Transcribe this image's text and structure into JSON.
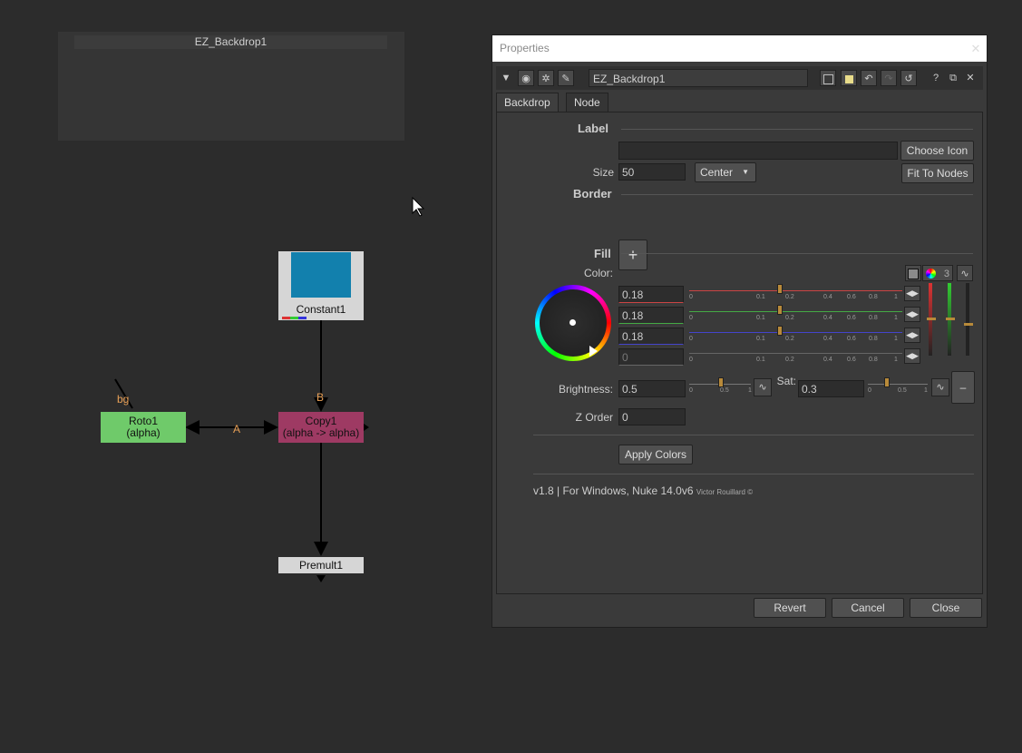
{
  "graph": {
    "backdrop_title": "EZ_Backdrop1",
    "nodes": {
      "constant": {
        "label": "Constant1",
        "color": "#1280ad"
      },
      "roto": {
        "label": "Roto1",
        "sub": "(alpha)"
      },
      "copy": {
        "label": "Copy1",
        "sub": "(alpha -> alpha)"
      },
      "premult": {
        "label": "Premult1"
      }
    },
    "edge_labels": {
      "bg": "bg",
      "a": "A",
      "b": "B"
    }
  },
  "properties": {
    "window_title": "Properties",
    "node_name": "EZ_Backdrop1",
    "tabs": [
      "Backdrop",
      "Node"
    ],
    "label_section": "Label",
    "choose_icon_label": "Choose Icon",
    "size_label": "Size",
    "size_value": "50",
    "align_value": "Center",
    "fit_to_nodes_label": "Fit To Nodes",
    "border_section": "Border",
    "border_add": "+",
    "fill_section": "Fill",
    "color_label": "Color:",
    "channel_count": "3",
    "channels": [
      "0.18",
      "0.18",
      "0.18",
      "0"
    ],
    "slider_ticks": [
      "0",
      "0.1",
      "0.2",
      "0.4",
      "0.6",
      "0.8",
      "1"
    ],
    "brightness_label": "Brightness:",
    "brightness_value": "0.5",
    "sat_label": "Sat:",
    "sat_value": "0.3",
    "small_ticks": [
      "0",
      "0.5",
      "1"
    ],
    "minus_label": "–",
    "z_order_label": "Z Order",
    "z_order_value": "0",
    "apply_colors_label": "Apply Colors",
    "version_text": "v1.8 | For Windows, Nuke 14.0v6",
    "author_text": "Victor Rouillard ©",
    "revert_label": "Revert",
    "cancel_label": "Cancel",
    "close_label": "Close"
  },
  "colors": {
    "accent": "#b88a3a",
    "roto": "#6fca6a",
    "copy": "#9e3a63",
    "constant": "#1280ad"
  }
}
